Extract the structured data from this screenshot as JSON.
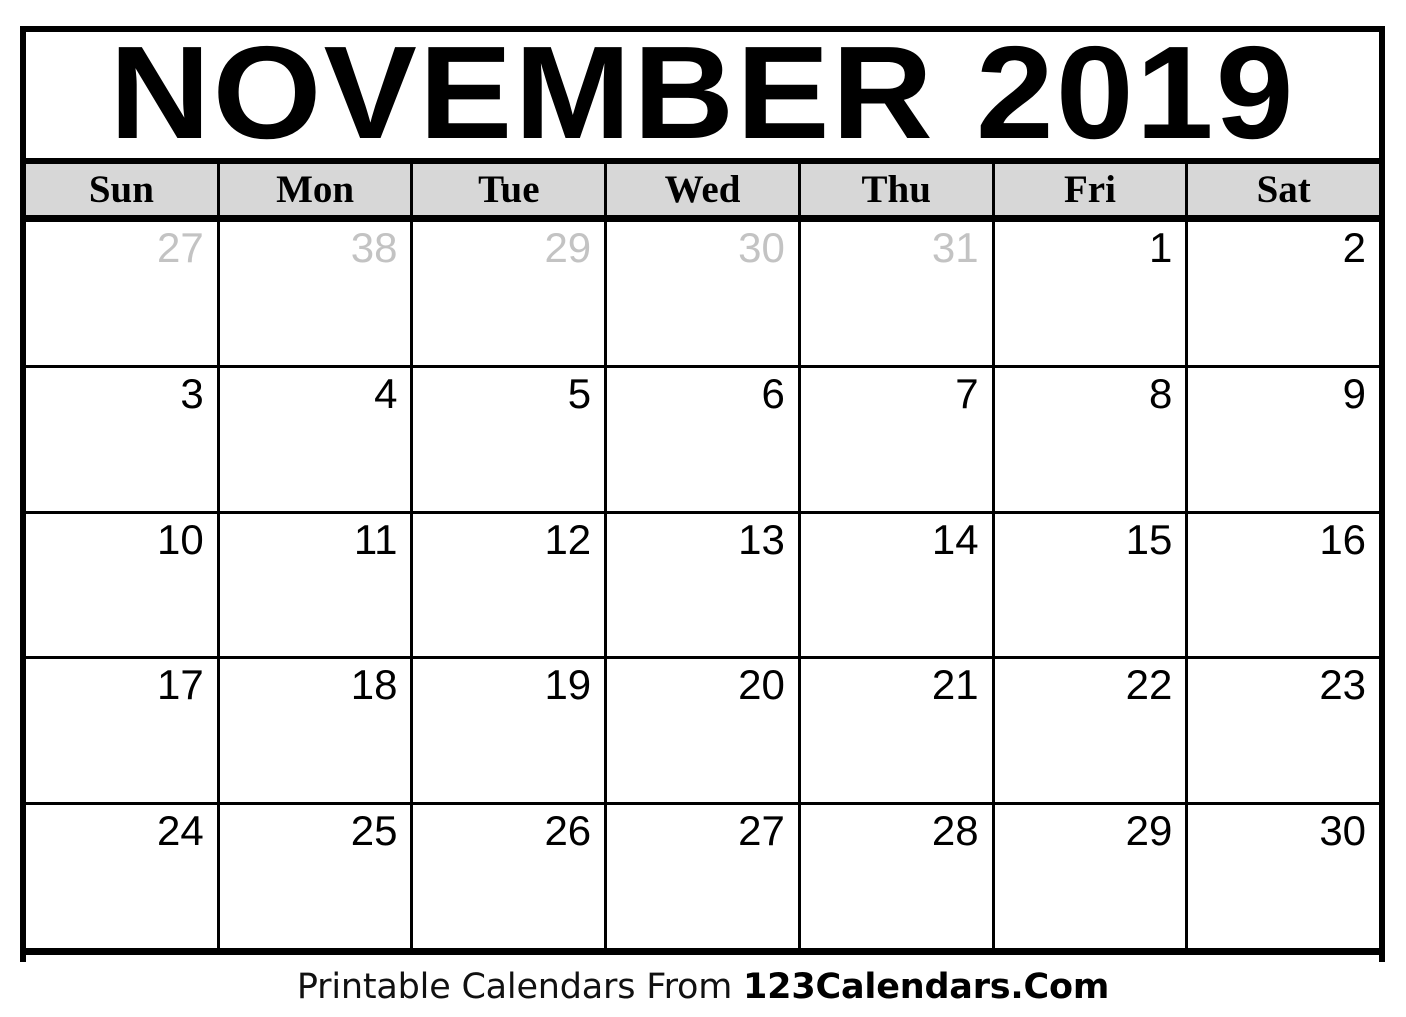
{
  "calendar": {
    "title": "NOVEMBER 2019",
    "month_name": "NOVEMBER",
    "year": "2019",
    "weekday_headers": [
      {
        "label": "Sun"
      },
      {
        "label": "Mon"
      },
      {
        "label": "Tue"
      },
      {
        "label": "Wed"
      },
      {
        "label": "Thu"
      },
      {
        "label": "Fri"
      },
      {
        "label": "Sat"
      }
    ],
    "weeks": [
      [
        {
          "day": "27",
          "adjacent": true
        },
        {
          "day": "38",
          "adjacent": true
        },
        {
          "day": "29",
          "adjacent": true
        },
        {
          "day": "30",
          "adjacent": true
        },
        {
          "day": "31",
          "adjacent": true
        },
        {
          "day": "1",
          "adjacent": false
        },
        {
          "day": "2",
          "adjacent": false
        }
      ],
      [
        {
          "day": "3",
          "adjacent": false
        },
        {
          "day": "4",
          "adjacent": false
        },
        {
          "day": "5",
          "adjacent": false
        },
        {
          "day": "6",
          "adjacent": false
        },
        {
          "day": "7",
          "adjacent": false
        },
        {
          "day": "8",
          "adjacent": false
        },
        {
          "day": "9",
          "adjacent": false
        }
      ],
      [
        {
          "day": "10",
          "adjacent": false
        },
        {
          "day": "11",
          "adjacent": false
        },
        {
          "day": "12",
          "adjacent": false
        },
        {
          "day": "13",
          "adjacent": false
        },
        {
          "day": "14",
          "adjacent": false
        },
        {
          "day": "15",
          "adjacent": false
        },
        {
          "day": "16",
          "adjacent": false
        }
      ],
      [
        {
          "day": "17",
          "adjacent": false
        },
        {
          "day": "18",
          "adjacent": false
        },
        {
          "day": "19",
          "adjacent": false
        },
        {
          "day": "20",
          "adjacent": false
        },
        {
          "day": "21",
          "adjacent": false
        },
        {
          "day": "22",
          "adjacent": false
        },
        {
          "day": "23",
          "adjacent": false
        }
      ],
      [
        {
          "day": "24",
          "adjacent": false
        },
        {
          "day": "25",
          "adjacent": false
        },
        {
          "day": "26",
          "adjacent": false
        },
        {
          "day": "27",
          "adjacent": false
        },
        {
          "day": "28",
          "adjacent": false
        },
        {
          "day": "29",
          "adjacent": false
        },
        {
          "day": "30",
          "adjacent": false
        }
      ]
    ]
  },
  "footer": {
    "text": "Printable Calendars From ",
    "brand": "123Calendars.Com"
  },
  "colors": {
    "header_background": "#d7d7d7",
    "grid_line": "#000000",
    "adjacent_day_text": "#c3c3c3",
    "day_text": "#000000",
    "page_background": "#ffffff"
  }
}
